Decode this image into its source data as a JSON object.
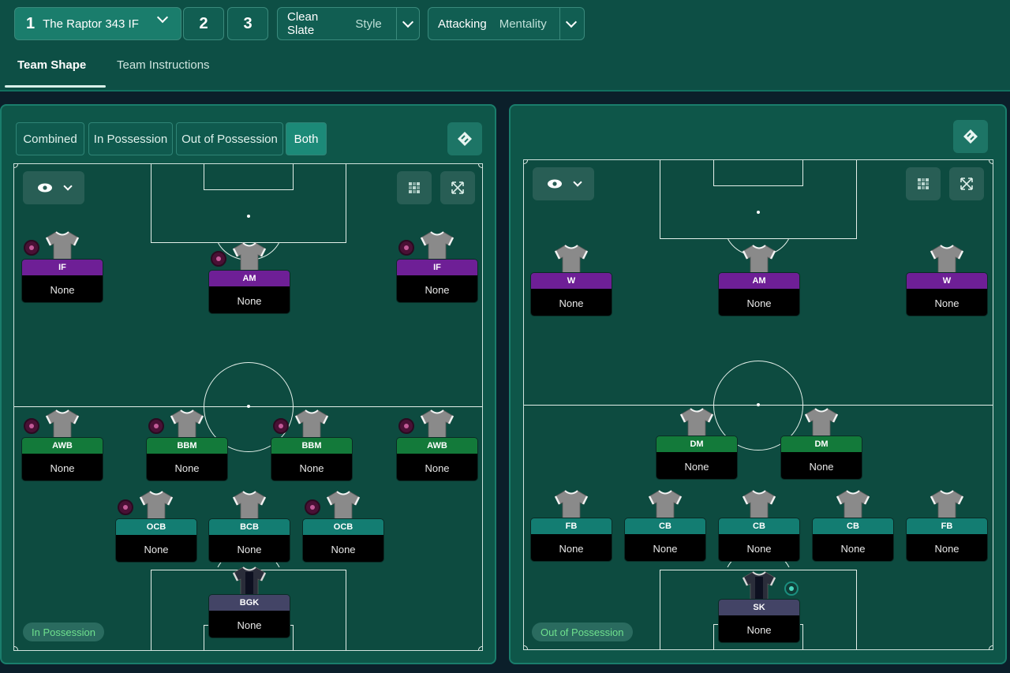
{
  "header": {
    "tactic_slot_number": "1",
    "tactic_name": "The Raptor 343 IF",
    "slot2": "2",
    "slot3": "3",
    "style_value": "Clean Slate",
    "style_label": "Style",
    "mentality_value": "Attacking",
    "mentality_label": "Mentality"
  },
  "tabs": [
    {
      "label": "Team Shape",
      "active": true
    },
    {
      "label": "Team Instructions",
      "active": false
    }
  ],
  "left_panel": {
    "modes": [
      {
        "label": "Combined"
      },
      {
        "label": "In Possession"
      },
      {
        "label": "Out of Possession"
      },
      {
        "label": "Both"
      }
    ],
    "badge": "In Possession",
    "players": [
      {
        "role": "IF",
        "duty": "None"
      },
      {
        "role": "AM",
        "duty": "None"
      },
      {
        "role": "IF",
        "duty": "None"
      },
      {
        "role": "AWB",
        "duty": "None"
      },
      {
        "role": "BBM",
        "duty": "None"
      },
      {
        "role": "BBM",
        "duty": "None"
      },
      {
        "role": "AWB",
        "duty": "None"
      },
      {
        "role": "OCB",
        "duty": "None"
      },
      {
        "role": "BCB",
        "duty": "None"
      },
      {
        "role": "OCB",
        "duty": "None"
      },
      {
        "role": "BGK",
        "duty": "None"
      }
    ]
  },
  "right_panel": {
    "badge": "Out of Possession",
    "players": [
      {
        "role": "W",
        "duty": "None"
      },
      {
        "role": "AM",
        "duty": "None"
      },
      {
        "role": "W",
        "duty": "None"
      },
      {
        "role": "DM",
        "duty": "None"
      },
      {
        "role": "DM",
        "duty": "None"
      },
      {
        "role": "FB",
        "duty": "None"
      },
      {
        "role": "CB",
        "duty": "None"
      },
      {
        "role": "CB",
        "duty": "None"
      },
      {
        "role": "CB",
        "duty": "None"
      },
      {
        "role": "FB",
        "duty": "None"
      },
      {
        "role": "SK",
        "duty": "None"
      }
    ]
  },
  "colors": {
    "attack_role": "#6e1f96",
    "midfield_role": "#137a3a",
    "defence_role": "#137d72",
    "goalkeeper_role": "#434466",
    "badge_text": "#6fe08e"
  },
  "icons": [
    "chevron-down-icon",
    "eye-icon",
    "grid-icon",
    "expand-icon",
    "swap-icon",
    "shirt-icon",
    "trait-icon"
  ]
}
